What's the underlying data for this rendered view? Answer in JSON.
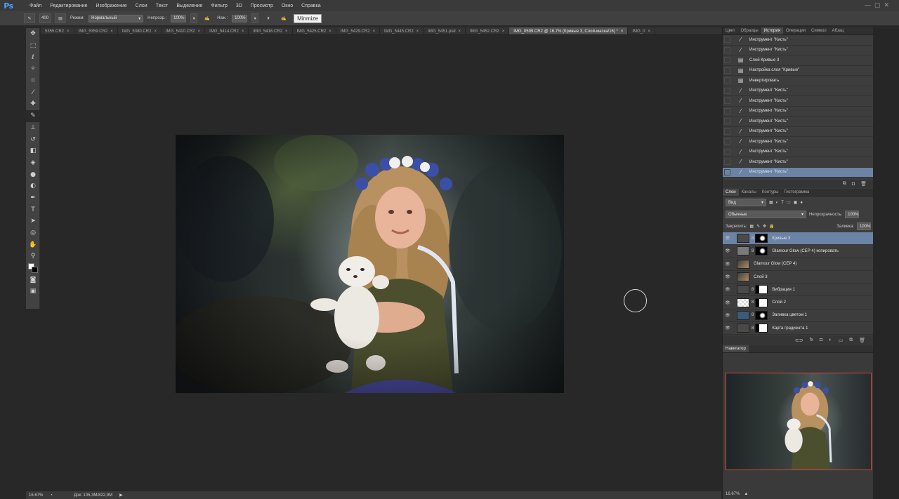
{
  "app": {
    "logo": "Ps"
  },
  "menu": [
    "Файл",
    "Редактирование",
    "Изображение",
    "Слои",
    "Текст",
    "Выделение",
    "Фильтр",
    "3D",
    "Просмотр",
    "Окно",
    "Справка"
  ],
  "options": {
    "size": "400",
    "mode_label": "Режим:",
    "mode_value": "Нормальный",
    "opacity_label": "Непрозр.:",
    "opacity_value": "100%",
    "pressure_label": "Наж.:",
    "pressure_value": "100%",
    "tooltip": "Minmize"
  },
  "doc_tabs": [
    {
      "label": "5355.CR2",
      "active": false
    },
    {
      "label": "IMG_5359.CR2",
      "active": false
    },
    {
      "label": "IMG_5380.CR2",
      "active": false
    },
    {
      "label": "IMG_5410.CR2",
      "active": false
    },
    {
      "label": "IMG_5414.CR2",
      "active": false
    },
    {
      "label": "IMG_5416.CR2",
      "active": false
    },
    {
      "label": "IMG_5425.CR2",
      "active": false
    },
    {
      "label": "IMG_5429.CR2",
      "active": false
    },
    {
      "label": "IMG_5445.CR2",
      "active": false
    },
    {
      "label": "IMG_5451.psd",
      "active": false
    },
    {
      "label": "IMG_5452.CR2",
      "active": false
    },
    {
      "label": "IMG_0599.CR2 @ 16.7% (Кривые 3, Слой-маска/16) *",
      "active": true
    },
    {
      "label": "IMG_0",
      "active": false
    }
  ],
  "history_tabs": [
    "Цвет",
    "Образцы",
    "История",
    "Операции",
    "Символ",
    "Абзац"
  ],
  "history_items": [
    {
      "label": "Инструмент \"Кисть\"",
      "icon": "brush"
    },
    {
      "label": "Инструмент \"Кисть\"",
      "icon": "brush"
    },
    {
      "label": "Слой Кривые 3",
      "icon": "layer"
    },
    {
      "label": "Настройка слоя \"Кривые\"",
      "icon": "layer"
    },
    {
      "label": "Инвертировать",
      "icon": "layer"
    },
    {
      "label": "Инструмент \"Кисть\"",
      "icon": "brush"
    },
    {
      "label": "Инструмент \"Кисть\"",
      "icon": "brush"
    },
    {
      "label": "Инструмент \"Кисть\"",
      "icon": "brush"
    },
    {
      "label": "Инструмент \"Кисть\"",
      "icon": "brush"
    },
    {
      "label": "Инструмент \"Кисть\"",
      "icon": "brush"
    },
    {
      "label": "Инструмент \"Кисть\"",
      "icon": "brush"
    },
    {
      "label": "Инструмент \"Кисть\"",
      "icon": "brush"
    },
    {
      "label": "Инструмент \"Кисть\"",
      "icon": "brush"
    },
    {
      "label": "Инструмент \"Кисть\"",
      "icon": "brush"
    }
  ],
  "layers_tabs": [
    "Слои",
    "Каналы",
    "Контуры",
    "Гистограмма"
  ],
  "layers_ctrl": {
    "filter": "Вид",
    "blend": "Обычные",
    "opacity_label": "Непрозрачность:",
    "opacity": "100%",
    "lock_label": "Закрепить:",
    "fill_label": "Заливка:",
    "fill": "100%"
  },
  "layers": [
    {
      "name": "Кривые 3",
      "thumb": "adj",
      "mask": "dark",
      "selected": true
    },
    {
      "name": "Glamour Glow (СЕР 4) копировать",
      "thumb": "gray",
      "mask": "dark",
      "selected": false
    },
    {
      "name": "Glamour Glow (СЕР 4)",
      "thumb": "photo",
      "mask": "",
      "selected": false
    },
    {
      "name": "Слой 3",
      "thumb": "photo",
      "mask": "",
      "selected": false
    },
    {
      "name": "Вибрация 1",
      "thumb": "adj",
      "mask": "white",
      "selected": false
    },
    {
      "name": "Слой 2",
      "thumb": "check",
      "mask": "white",
      "selected": false
    },
    {
      "name": "Заливка цветом 1",
      "thumb": "blue",
      "mask": "dark",
      "selected": false
    },
    {
      "name": "Карта градиента 1",
      "thumb": "adj",
      "mask": "white",
      "selected": false
    }
  ],
  "navigator": {
    "title": "Навигатор",
    "zoom": "16.67%"
  },
  "status": {
    "zoom": "16.67%",
    "doc": "Док: 105,3M/822,9M"
  }
}
